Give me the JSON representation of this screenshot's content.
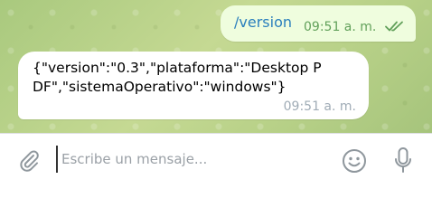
{
  "messages": [
    {
      "direction": "outgoing",
      "text": "/version",
      "time": "09:51 a. m.",
      "status_icon": "double-check-icon"
    },
    {
      "direction": "incoming",
      "text": "{\"version\":\"0.3\",\"plataforma\":\"Desktop PDF\",\"sistemaOperativo\":\"windows\"}",
      "time": "09:51 a. m."
    }
  ],
  "composer": {
    "placeholder": "Escribe un mensaje...",
    "value": "",
    "icons": [
      "paperclip-icon",
      "smiley-icon",
      "microphone-icon"
    ]
  },
  "colors": {
    "outgoing_bubble": "#effdde",
    "incoming_bubble": "#ffffff",
    "command_link": "#2a7fbd",
    "outgoing_meta": "#61a05a",
    "incoming_meta": "#a0acb6",
    "chat_background": "#b9d28a"
  }
}
